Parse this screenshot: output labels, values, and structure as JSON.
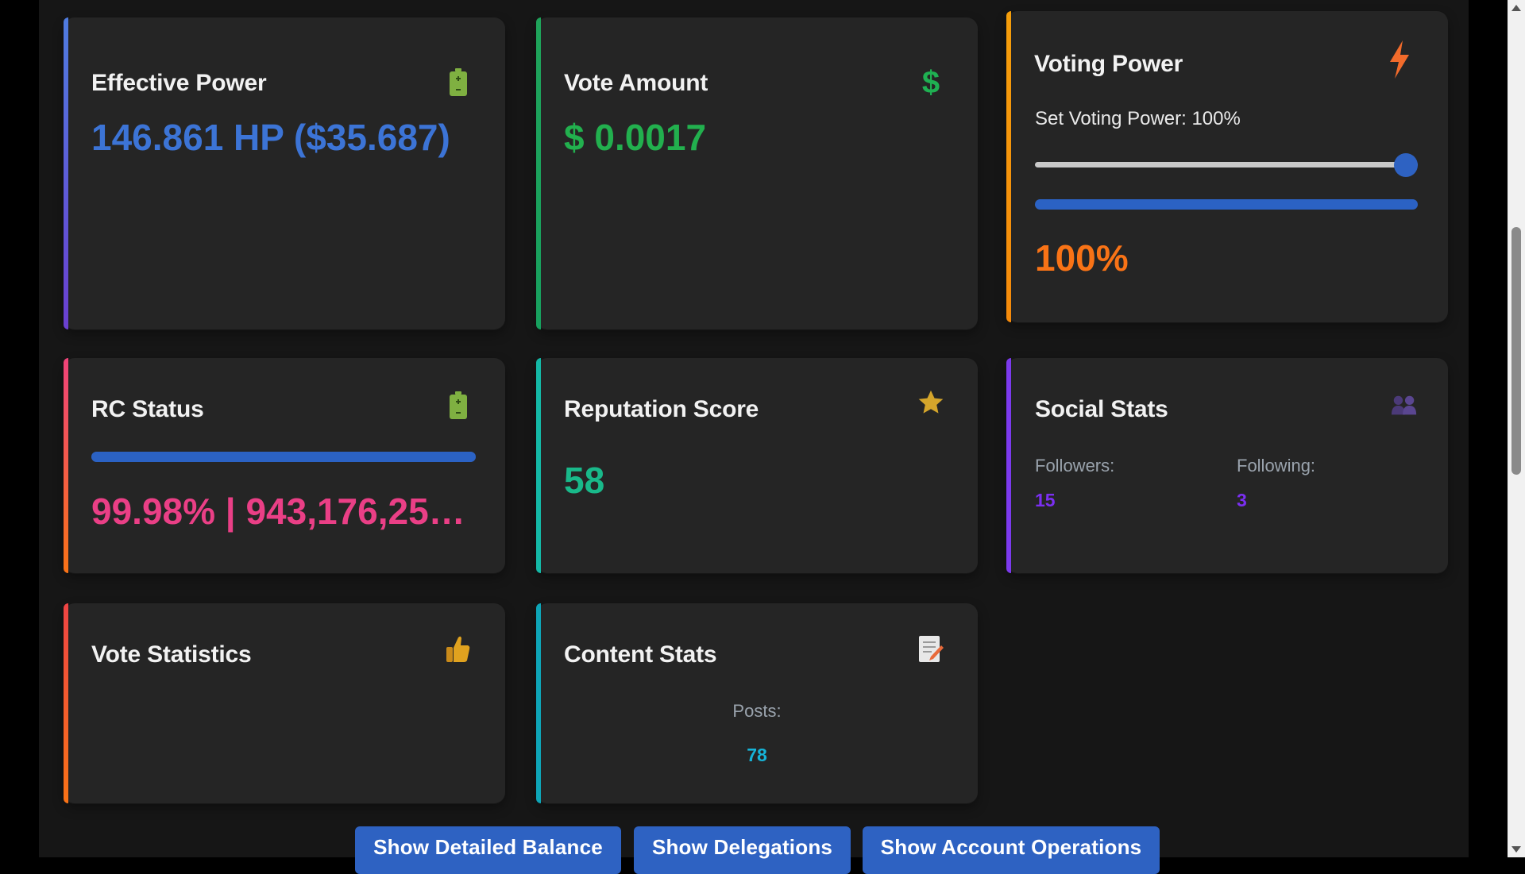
{
  "cards": {
    "effective_power": {
      "title": "Effective Power",
      "value": "146.861 HP ($35.687)",
      "icon": "battery-icon",
      "accent": "#5b4fc9",
      "value_color": "#3c74d6"
    },
    "vote_amount": {
      "title": "Vote Amount",
      "value": "$ 0.0017",
      "icon": "dollar-icon",
      "accent": "#1fa35a",
      "value_color": "#22b04e"
    },
    "voting_power": {
      "title": "Voting Power",
      "slider_label": "Set Voting Power: 100%",
      "slider_value": 100,
      "bar_percent": 100,
      "value": "100%",
      "icon": "lightning-icon",
      "accent": "#f59e0b",
      "value_color": "#f97316"
    },
    "rc_status": {
      "title": "RC Status",
      "value": "99.98% | 943,176,25…",
      "bar_percent": 99.98,
      "icon": "battery-icon",
      "accent": "#f97316",
      "value_color": "#ea3f86"
    },
    "reputation": {
      "title": "Reputation Score",
      "value": "58",
      "icon": "star-icon",
      "accent": "#14b8a6",
      "value_color": "#19b98a"
    },
    "social": {
      "title": "Social Stats",
      "followers_label": "Followers:",
      "followers_value": "15",
      "following_label": "Following:",
      "following_value": "3",
      "icon": "people-icon",
      "accent": "#7c3aed",
      "value_color": "#7b2ff2"
    },
    "vote_stats": {
      "title": "Vote Statistics",
      "icon": "thumbs-up-icon",
      "accent": "#ef4444"
    },
    "content": {
      "title": "Content Stats",
      "posts_label": "Posts:",
      "posts_value": "78",
      "icon": "memo-icon",
      "accent": "#0ea5b7",
      "value_color": "#16b4d8"
    }
  },
  "actions": {
    "detailed_balance": "Show Detailed Balance",
    "delegations": "Show Delegations",
    "account_operations": "Show Account Operations"
  }
}
